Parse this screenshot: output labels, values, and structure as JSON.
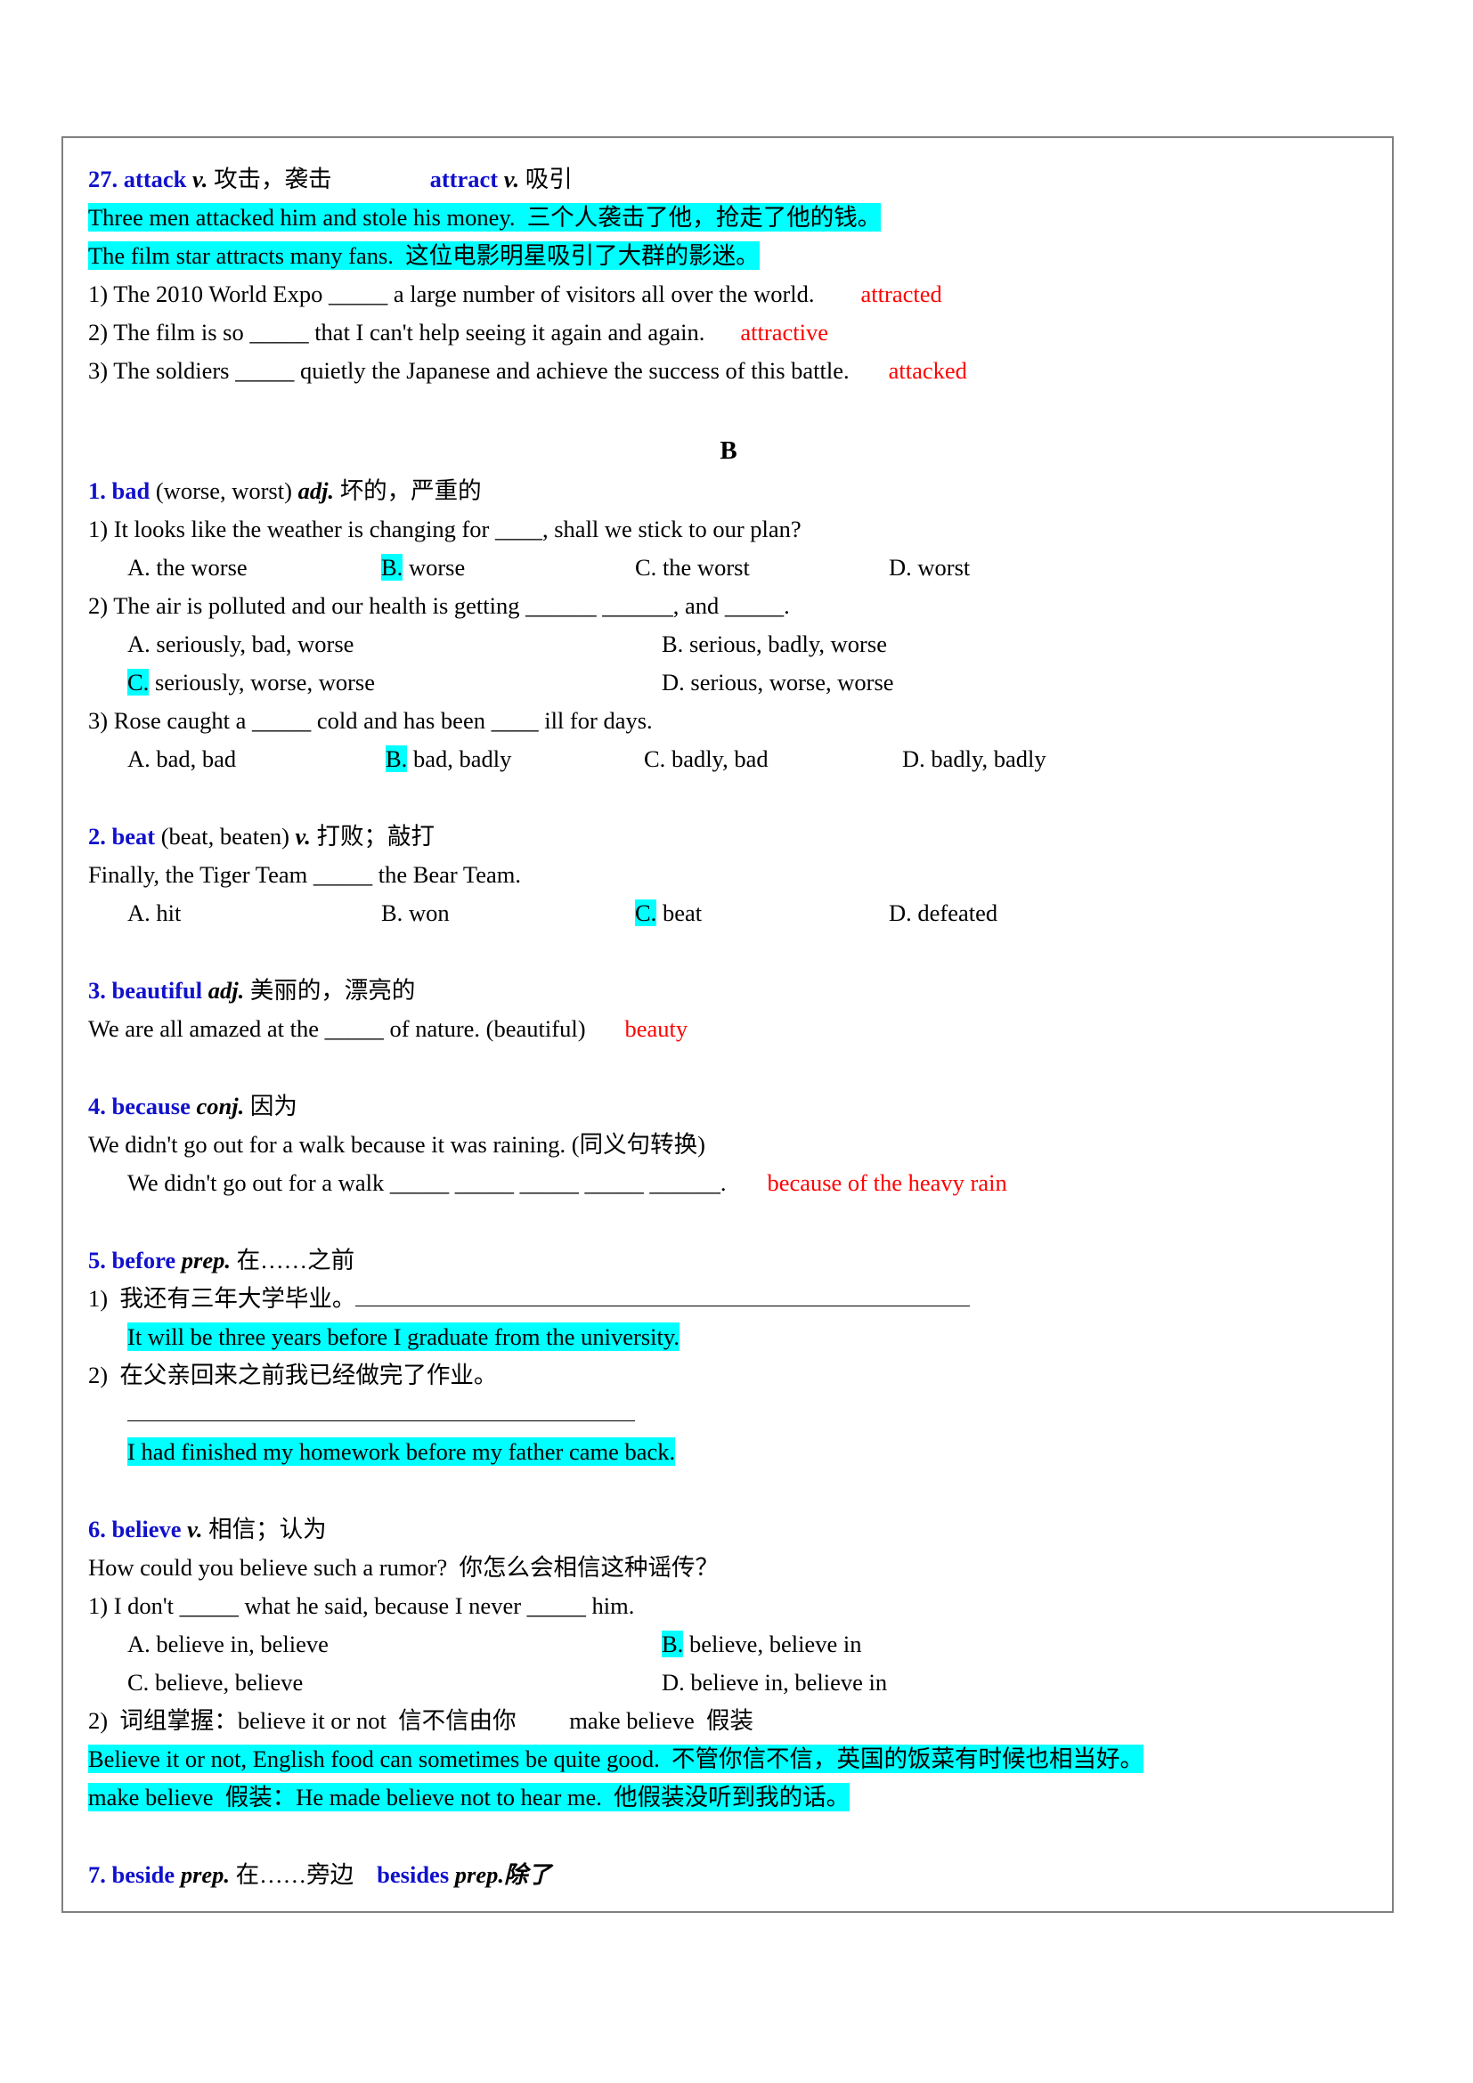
{
  "document": {
    "section_letter": "B"
  },
  "entry_27": {
    "head_num": "27. ",
    "head_word": "attack",
    "head_pos": " v.",
    "head_cn": " 攻击，袭击",
    "head2_word": "attract",
    "head2_pos": " v.",
    "head2_cn": " 吸引",
    "example1": "Three men attacked him and stole his money.  三个人袭击了他，抢走了他的钱。",
    "example2": "The film star attracts many fans.  这位电影明星吸引了大群的影迷。",
    "q1": "1) The 2010 World Expo _____ a large number of visitors all over the world.",
    "a1": "attracted",
    "q2": "2) The film is so _____ that I can't help seeing it again and again.",
    "a2": "attractive",
    "q3": "3) The soldiers _____ quietly the Japanese and achieve the success of this battle.",
    "a3": "attacked"
  },
  "entry_b1": {
    "head_num": "1. ",
    "head_word": "bad",
    "head_rest": " (worse, worst) ",
    "head_pos": "adj.",
    "head_cn": " 坏的，严重的",
    "q1": "1) It looks like the weather is changing for ____, shall we stick to our plan?",
    "q1_options": [
      {
        "mark": "A.",
        "text": " the worse",
        "correct": false
      },
      {
        "mark": "B.",
        "text": " worse",
        "correct": true
      },
      {
        "mark": "C.",
        "text": " the worst",
        "correct": false
      },
      {
        "mark": "D.",
        "text": " worst",
        "correct": false
      }
    ],
    "q2": "2) The air is polluted and our health is getting ______ ______, and _____.",
    "q2_options_row1": [
      {
        "mark": "A.",
        "text": " seriously, bad, worse",
        "correct": false
      },
      {
        "mark": "B.",
        "text": " serious, badly, worse",
        "correct": false
      }
    ],
    "q2_options_row2": [
      {
        "mark": "C.",
        "text": " seriously, worse, worse",
        "correct": true
      },
      {
        "mark": "D.",
        "text": " serious, worse, worse",
        "correct": false
      }
    ],
    "q3": "3) Rose caught a _____ cold and has been ____ ill for days.",
    "q3_options": [
      {
        "mark": "A.",
        "text": " bad, bad",
        "correct": false
      },
      {
        "mark": "B.",
        "text": " bad, badly",
        "correct": true
      },
      {
        "mark": "C.",
        "text": " badly, bad",
        "correct": false
      },
      {
        "mark": "D.",
        "text": " badly, badly",
        "correct": false
      }
    ]
  },
  "entry_b2": {
    "head_num": "2. ",
    "head_word": "beat",
    "head_rest": " (beat, beaten) ",
    "head_pos": "v.",
    "head_cn": " 打败；敲打",
    "q1": "Finally, the Tiger Team _____ the Bear Team.",
    "q1_options": [
      {
        "mark": "A.",
        "text": " hit",
        "correct": false
      },
      {
        "mark": "B.",
        "text": " won",
        "correct": false
      },
      {
        "mark": "C.",
        "text": " beat",
        "correct": true
      },
      {
        "mark": "D.",
        "text": " defeated",
        "correct": false
      }
    ]
  },
  "entry_b3": {
    "head_num": "3. ",
    "head_word": "beautiful",
    "head_pos": " adj.",
    "head_cn": " 美丽的，漂亮的",
    "q1": "We are all amazed at the _____ of nature. (beautiful)",
    "a1": "beauty"
  },
  "entry_b4": {
    "head_num": "4. ",
    "head_word": "because",
    "head_pos": " conj.",
    "head_cn": " 因为",
    "q1": "We didn't go out for a walk because it was raining. (同义句转换)",
    "q2": "We didn't go out for a walk _____ _____ _____ _____ ______.",
    "a2": "because of the heavy rain"
  },
  "entry_b5": {
    "head_num": "5. ",
    "head_word": "before",
    "head_pos": " prep.",
    "head_cn": " 在……之前",
    "q1": "1)  我还有三年大学毕业。",
    "a1": "It will be three years before I graduate from the university.",
    "q2": "2)  在父亲回来之前我已经做完了作业。",
    "a2": "I had finished my homework before my father came back."
  },
  "entry_b6": {
    "head_num": "6. ",
    "head_word": "believe",
    "head_pos": " v.",
    "head_cn": " 相信；认为",
    "example1": "How could you believe such a rumor?  你怎么会相信这种谣传？",
    "q1": "1) I don't _____ what he said, because I never _____ him.",
    "q1_options_row1": [
      {
        "mark": "A.",
        "text": " believe in, believe",
        "correct": false
      },
      {
        "mark": "B.",
        "text": " believe, believe in",
        "correct": true
      }
    ],
    "q1_options_row2": [
      {
        "mark": "C.",
        "text": " believe, believe",
        "correct": false
      },
      {
        "mark": "D.",
        "text": " believe in, believe in",
        "correct": false
      }
    ],
    "q2": "2)  词组掌握：believe it or not  信不信由你         make believe  假装",
    "example2": "Believe it or not, English food can sometimes be quite good.  不管你信不信，英国的饭菜有时候也相当好。",
    "example3": "make believe  假装：He made believe not to hear me.  他假装没听到我的话。"
  },
  "entry_b7": {
    "head_num": "7. ",
    "head_word": "beside",
    "head_pos": " prep.",
    "head_cn": " 在……旁边",
    "head2_word": "besides",
    "head2_pos": " prep.",
    "head2_cn": "除了"
  },
  "colors": {
    "highlight": "#00ffff",
    "answer": "#ff0000",
    "headword": "#1111cc",
    "border": "#808080"
  }
}
